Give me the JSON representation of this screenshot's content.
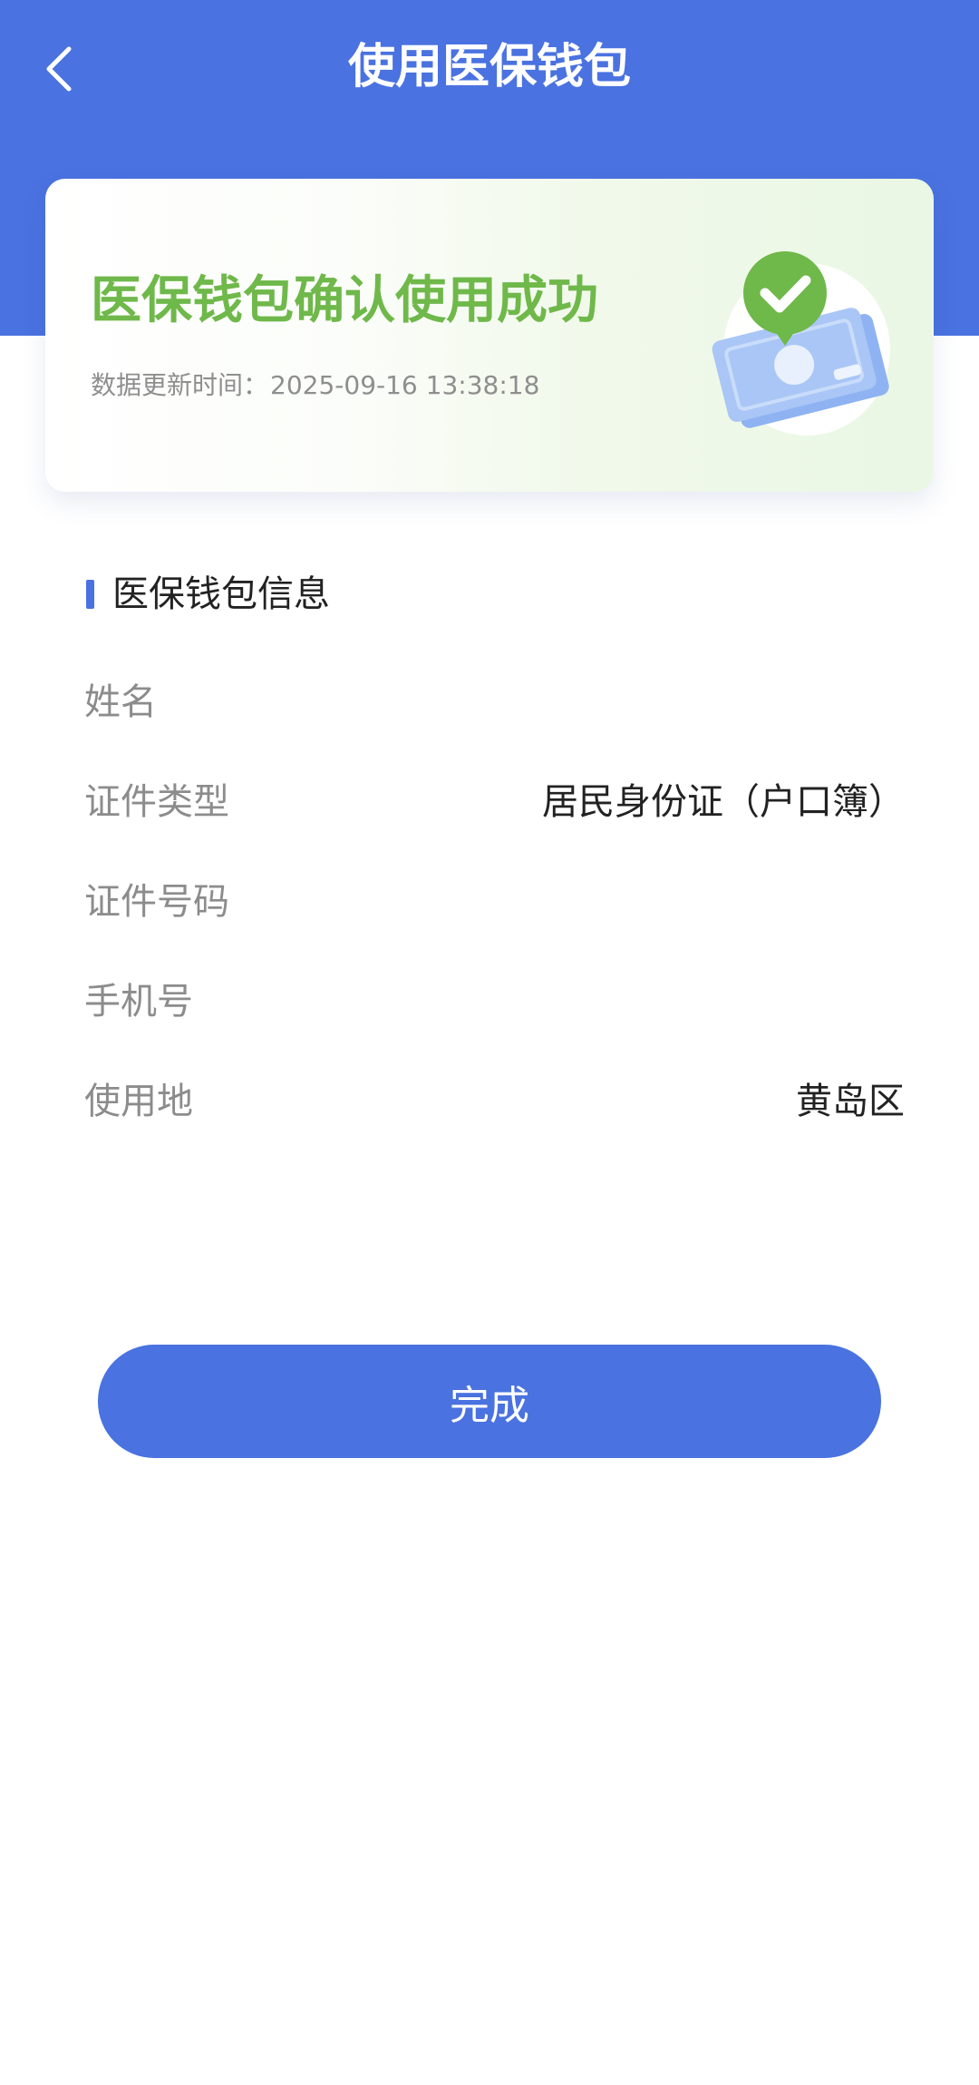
{
  "header": {
    "title": "使用医保钱包",
    "back_icon": "chevron-left-icon",
    "background_color": "#4a72e0"
  },
  "status_card": {
    "title": "医保钱包确认使用成功",
    "time_label": "数据更新时间：",
    "time_value": "2025-09-16 13:38:18",
    "title_color": "#6fb84a",
    "illustration_icon": "money-check-icon"
  },
  "info_section": {
    "title": "医保钱包信息",
    "rows": [
      {
        "label": "姓名",
        "value": ""
      },
      {
        "label": "证件类型",
        "value": "居民身份证（户口簿）"
      },
      {
        "label": "证件号码",
        "value": ""
      },
      {
        "label": "手机号",
        "value": ""
      },
      {
        "label": "使用地",
        "value": "黄岛区"
      }
    ]
  },
  "actions": {
    "done_label": "完成"
  }
}
